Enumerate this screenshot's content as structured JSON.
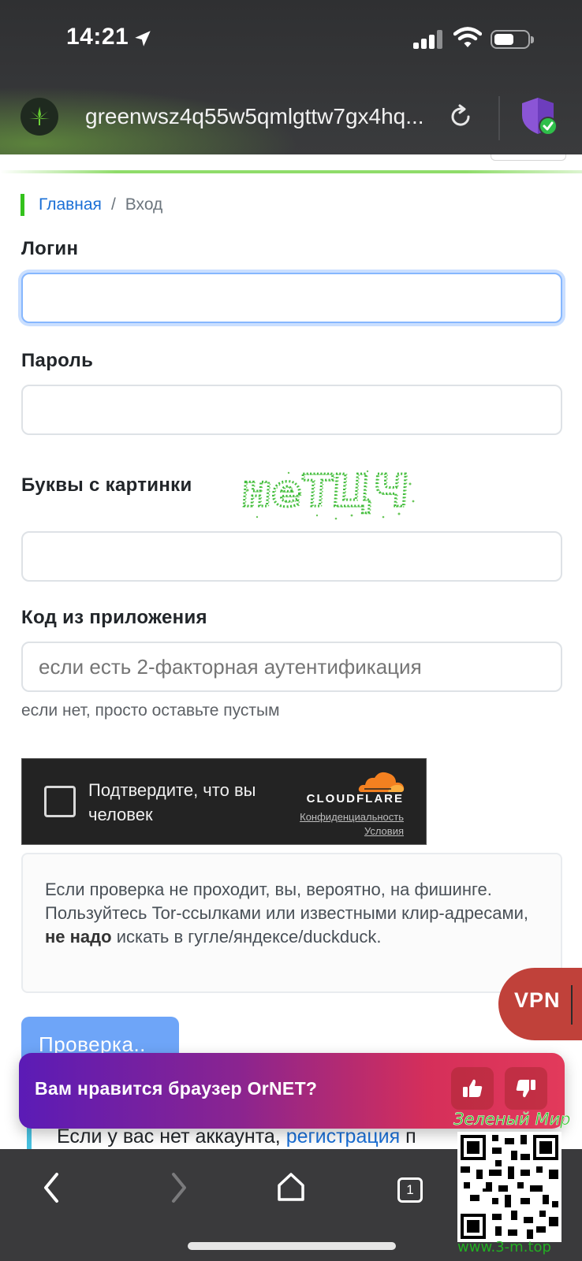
{
  "status_bar": {
    "time": "14:21"
  },
  "browser": {
    "url": "greenwsz4q55w5qmlgttw7gx4hq...",
    "site_icon": "cannabis-leaf-icon",
    "reload_icon": "reload-icon",
    "shield_icon": "shield-check-icon"
  },
  "breadcrumb": {
    "home": "Главная",
    "separator": "/",
    "current": "Вход"
  },
  "form": {
    "login_label": "Логин",
    "login_value": "",
    "password_label": "Пароль",
    "password_value": "",
    "captcha_label": "Буквы с картинки",
    "captcha_image_text": "НеТЦЧ",
    "captcha_value": "",
    "code_label": "Код из приложения",
    "code_placeholder": "если есть 2-факторная аутентификация",
    "code_hint": "если нет, просто оставьте пустым"
  },
  "turnstile": {
    "text": "Подтвердите, что вы человек",
    "brand": "CLOUDFLARE",
    "privacy": "Конфиденциальность",
    "terms": "Условия"
  },
  "alert": {
    "line1": "Если проверка не проходит, вы, вероятно, на фишинге.",
    "line2_start": "Пользуйтесь Tor-ссылками или известными клир-адресами,",
    "line2_bold": "не надо",
    "line2_end": "искать в гугле/яндексе/duckduck."
  },
  "check_button": "Проверка..",
  "register": {
    "text": "Если у вас нет аккаунта,",
    "link": "регистрация",
    "after": "п"
  },
  "vpn_button": "VPN",
  "rating_banner": {
    "text": "Вам нравится браузер OrNET?",
    "like_icon": "thumbs-up-icon",
    "dislike_icon": "thumbs-down-icon"
  },
  "toolbar": {
    "tab_count": "1"
  },
  "watermark": {
    "title": "Зеленый Мир",
    "url": "www.3-m.top"
  },
  "colors": {
    "link": "#1a6fd6",
    "accent_green": "#34c21c",
    "primary_button": "#6ea5f8",
    "vpn": "#c0413a",
    "turnstile_bg": "#232323",
    "cloudflare_orange": "#f38020"
  }
}
